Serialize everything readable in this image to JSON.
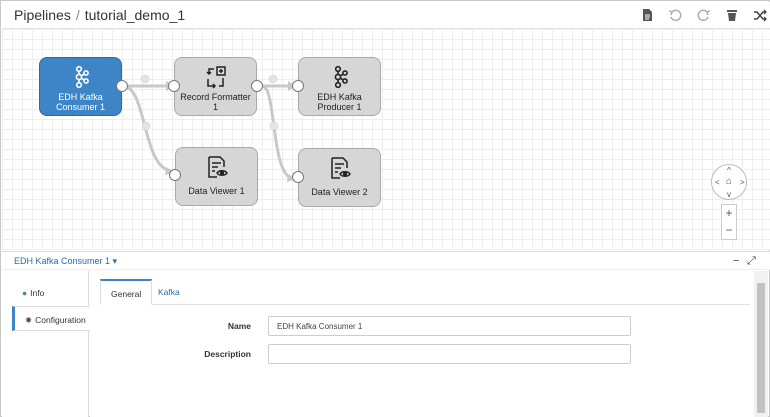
{
  "breadcrumb": {
    "root": "Pipelines",
    "separator": "/",
    "current": "tutorial_demo_1"
  },
  "toolbar": {
    "icons": [
      "file-icon",
      "undo-icon",
      "redo-icon",
      "delete-icon",
      "shuffle-icon"
    ]
  },
  "nodes": [
    {
      "id": "kafka_consumer",
      "label": "EDH Kafka Consumer 1",
      "icon": "kafka-icon",
      "selected": true
    },
    {
      "id": "record_formatter",
      "label": "Record Formatter 1",
      "icon": "formatter-icon",
      "selected": false
    },
    {
      "id": "kafka_producer",
      "label": "EDH Kafka Producer 1",
      "icon": "kafka-icon",
      "selected": false
    },
    {
      "id": "data_viewer_1",
      "label": "Data Viewer 1",
      "icon": "viewer-icon",
      "selected": false
    },
    {
      "id": "data_viewer_2",
      "label": "Data Viewer 2",
      "icon": "viewer-icon",
      "selected": false
    }
  ],
  "nav": {
    "up": "^",
    "down": "v",
    "left": "<",
    "right": ">",
    "home": "⌂",
    "zoom_in": "+",
    "zoom_out": "−"
  },
  "panel": {
    "title": "EDH Kafka Consumer 1 ▾",
    "minimize": "−",
    "expand": "⤢",
    "side": {
      "info": "Info",
      "configuration": "Configuration"
    },
    "tabs": {
      "general": "General",
      "kafka": "Kafka"
    },
    "fields": {
      "name_label": "Name",
      "name_value": "EDH Kafka Consumer 1",
      "description_label": "Description",
      "description_value": ""
    }
  },
  "colors": {
    "accent": "#3d85c6",
    "node": "#d6d6d6",
    "link": "#c6c6c6"
  }
}
